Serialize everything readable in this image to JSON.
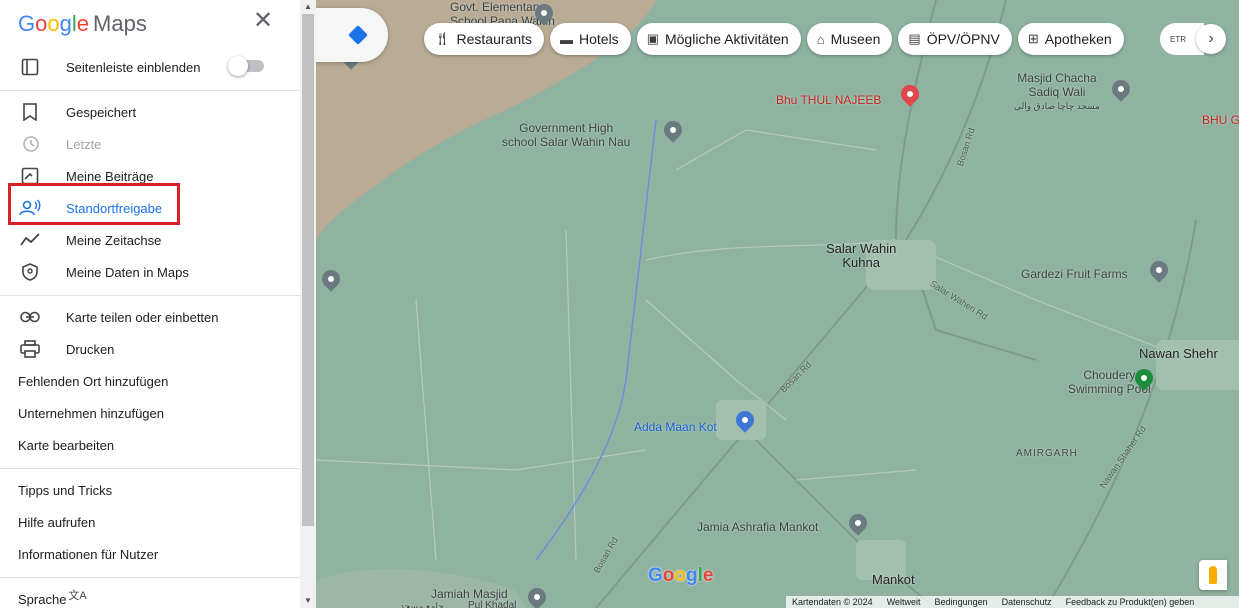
{
  "app": {
    "logo": {
      "g1": "G",
      "g2": "o",
      "g3": "o",
      "g4": "g",
      "g5": "l",
      "g6": "e",
      "maps": "Maps"
    }
  },
  "sidebar": {
    "toggle_label": "Seitenleiste einblenden",
    "toggle_state": "off",
    "group1": [
      {
        "label": "Gespeichert",
        "icon": "bookmark-icon"
      },
      {
        "label": "Letzte",
        "icon": "history-icon",
        "state": "disabled"
      },
      {
        "label": "Meine Beiträge",
        "icon": "contributions-icon"
      },
      {
        "label": "Standortfreigabe",
        "icon": "location-sharing-icon",
        "state": "active"
      },
      {
        "label": "Meine Zeitachse",
        "icon": "timeline-icon"
      },
      {
        "label": "Meine Daten in Maps",
        "icon": "shield-icon"
      }
    ],
    "group2": [
      {
        "label": "Karte teilen oder einbetten",
        "icon": "link-icon"
      },
      {
        "label": "Drucken",
        "icon": "print-icon"
      },
      {
        "label": "Fehlenden Ort hinzufügen"
      },
      {
        "label": "Unternehmen hinzufügen"
      },
      {
        "label": "Karte bearbeiten"
      }
    ],
    "group3": [
      {
        "label": "Tipps und Tricks"
      },
      {
        "label": "Hilfe aufrufen"
      },
      {
        "label": "Informationen für Nutzer"
      }
    ],
    "language": {
      "label": "Sprache",
      "icon": "translate-icon"
    }
  },
  "chips": [
    {
      "label": "Restaurants",
      "icon": "restaurant-icon"
    },
    {
      "label": "Hotels",
      "icon": "hotel-icon"
    },
    {
      "label": "Mögliche Aktivitäten",
      "icon": "camera-icon"
    },
    {
      "label": "Museen",
      "icon": "museum-icon"
    },
    {
      "label": "ÖPV/ÖPNV",
      "icon": "transit-icon"
    },
    {
      "label": "Apotheken",
      "icon": "pharmacy-icon"
    }
  ],
  "chip_partial": "ETR",
  "map_labels": {
    "school_top_1": "Govt. Elementary",
    "school_top_2": "School Pana Wahin",
    "masjid_chacha_1": "Masjid Chacha",
    "masjid_chacha_2": "Sadiq Wali",
    "masjid_chacha_urdu": "مسجد چاچا صادق والی",
    "bhu_thul": "Bhu THUL NAJEEB",
    "bhu_right": "BHU G",
    "gov_high_1": "Government High",
    "gov_high_2": "school Salar Wahin Nau",
    "bosan_rd_1": "Bosan Rd",
    "salar_1": "Salar Wahin",
    "salar_2": "Kuhna",
    "gardezi": "Gardezi Fruit Farms",
    "salar_road": "Salar Wahen Rd",
    "nawan_shehr": "Nawan Shehr",
    "choudery_1": "Choudery",
    "choudery_2": "Swimming Pool",
    "bosan_rd_2": "Bosan Rd",
    "adda": "Adda Maan Kot",
    "amirgarh": "AMIRGARH",
    "nawan_road": "Nawan Shaher Rd",
    "jamia_ashrafia": "Jamia Ashrafia Mankot",
    "bosan_rd_3": "Bosan Rd",
    "jamiah_1": "Jamiah Masjid",
    "jamiah_urdu": "جامع مسجد",
    "jamiah_2": "Pul Khadal",
    "mankot": "Mankot"
  },
  "footer": [
    "Kartendaten © 2024",
    "Weltweit",
    "Bedingungen",
    "Datenschutz",
    "Feedback zu Produkt(en) geben"
  ],
  "colors": {
    "accent": "#1a73e8",
    "highlight": "#d91f26",
    "map_green": "#8fb3a0",
    "map_tan": "#b9ab94"
  }
}
